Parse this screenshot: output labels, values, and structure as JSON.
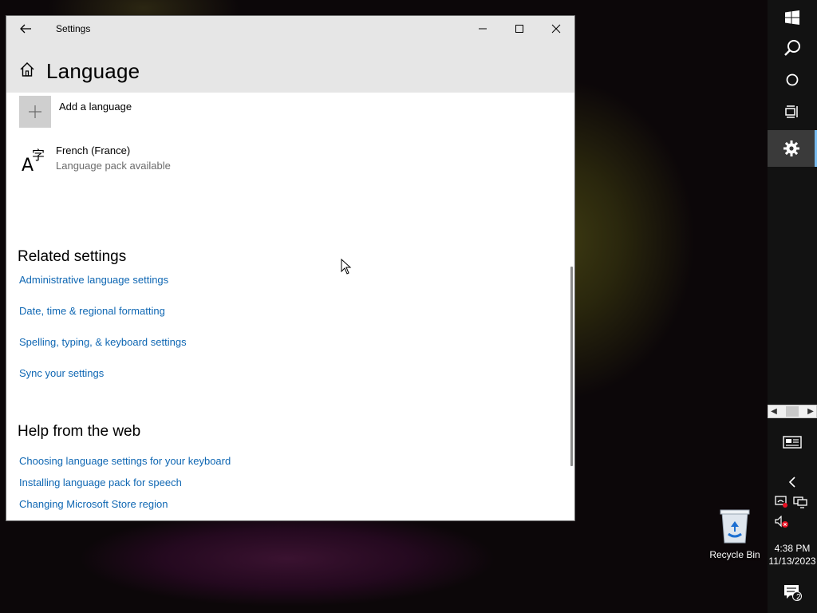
{
  "window": {
    "title": "Settings",
    "page_heading": "Language"
  },
  "languages": {
    "add_label": "Add a language",
    "items": [
      {
        "name": "French (France)",
        "status": "Language pack available"
      }
    ]
  },
  "related": {
    "title": "Related settings",
    "links": [
      "Administrative language settings",
      "Date, time & regional formatting",
      "Spelling, typing, & keyboard settings",
      "Sync your settings"
    ]
  },
  "help": {
    "title": "Help from the web",
    "links": [
      "Choosing language settings for your keyboard",
      "Installing language pack for speech",
      "Changing Microsoft Store region"
    ]
  },
  "desktop": {
    "recycle_bin_label": "Recycle Bin"
  },
  "taskbar": {
    "time": "4:38 PM",
    "date": "11/13/2023",
    "notification_count": "2",
    "icons": [
      "windows-start-icon",
      "search-icon",
      "cortana-icon",
      "task-view-icon",
      "settings-gear-icon",
      "news-icon",
      "chevron-left-icon",
      "network-icon",
      "display-icon",
      "volume-muted-icon",
      "action-center-icon"
    ]
  },
  "colors": {
    "link": "#0f67b3",
    "titlebar": "#e6e6e6",
    "accent": "#76b9ed"
  }
}
